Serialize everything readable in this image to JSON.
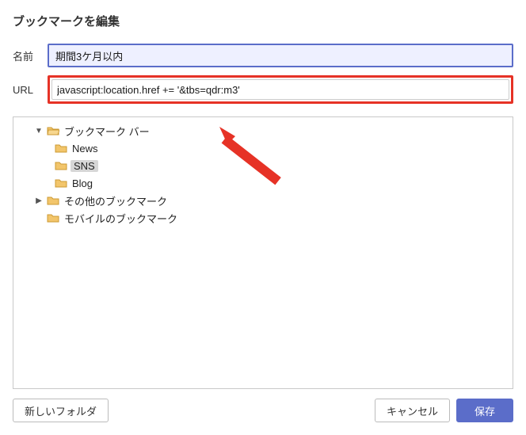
{
  "dialog": {
    "title": "ブックマークを編集",
    "name_label": "名前",
    "url_label": "URL",
    "name_value": "期間3ケ月以内",
    "url_value": "javascript:location.href += '&tbs=qdr:m3'"
  },
  "tree": {
    "nodes": [
      {
        "label": "ブックマーク バー",
        "depth": 0,
        "expanded": true,
        "open": true
      },
      {
        "label": "News",
        "depth": 1,
        "open": false
      },
      {
        "label": "SNS",
        "depth": 1,
        "open": false,
        "selected": true
      },
      {
        "label": "Blog",
        "depth": 1,
        "open": false
      },
      {
        "label": "その他のブックマーク",
        "depth": 0,
        "expanded": false,
        "open": false
      },
      {
        "label": "モバイルのブックマーク",
        "depth": 0,
        "open": false
      }
    ]
  },
  "buttons": {
    "new_folder": "新しいフォルダ",
    "cancel": "キャンセル",
    "save": "保存"
  }
}
